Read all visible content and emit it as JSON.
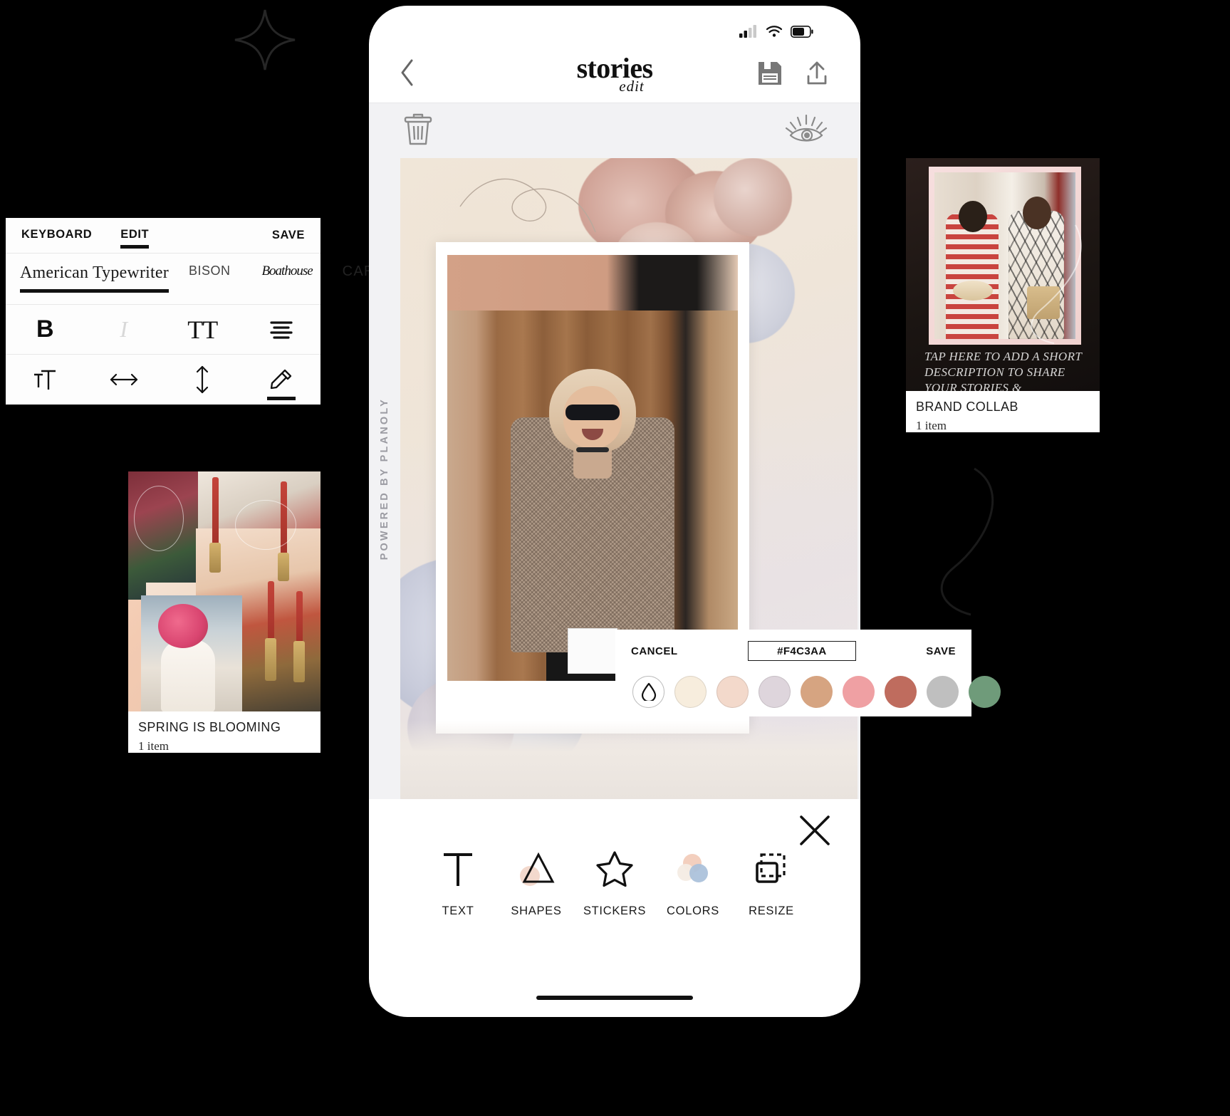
{
  "text_panel": {
    "tabs": [
      {
        "label": "KEYBOARD",
        "active": false
      },
      {
        "label": "EDIT",
        "active": true
      }
    ],
    "save_label": "SAVE",
    "fonts": [
      {
        "label": "American Typewriter",
        "active": true
      },
      {
        "label": "BISON",
        "active": false
      },
      {
        "label": "Boathouse",
        "active": false
      },
      {
        "label": "CARROL",
        "active": false
      }
    ],
    "format_row": [
      {
        "icon": "bold-icon",
        "label": "B",
        "active": true
      },
      {
        "icon": "italic-icon",
        "label": "I",
        "active": false
      },
      {
        "icon": "text-case-icon",
        "label": "TT",
        "active": false
      },
      {
        "icon": "align-center-icon",
        "label": "",
        "active": false
      }
    ],
    "spacing_row": [
      {
        "icon": "font-size-icon",
        "active": false
      },
      {
        "icon": "letter-spacing-icon",
        "active": false
      },
      {
        "icon": "line-height-icon",
        "active": false
      },
      {
        "icon": "color-eyedropper-icon",
        "active": true
      }
    ]
  },
  "phone": {
    "status": {
      "signal": "signal-bars-icon",
      "wifi": "wifi-icon",
      "battery": "battery-icon"
    },
    "nav": {
      "back_icon": "chevron-left-icon",
      "title": "stories",
      "subtitle": "edit",
      "save_icon": "floppy-save-icon",
      "share_icon": "upload-share-icon"
    },
    "canvas_bar": {
      "delete_icon": "trash-icon",
      "preview_icon": "eye-lashes-icon"
    },
    "watermark": "POWERED BY PLANOLY",
    "close_icon": "close-x-icon",
    "toolbar": [
      {
        "icon": "text-t-icon",
        "label": "TEXT"
      },
      {
        "icon": "shapes-triangle-icon",
        "label": "SHAPES"
      },
      {
        "icon": "star-sticker-icon",
        "label": "STICKERS"
      },
      {
        "icon": "color-circles-icon",
        "label": "COLORS"
      },
      {
        "icon": "resize-frame-icon",
        "label": "RESIZE"
      }
    ]
  },
  "color_picker": {
    "cancel_label": "CANCEL",
    "save_label": "SAVE",
    "hex_value": "#F4C3AA",
    "swatches": [
      {
        "name": "eyedropper",
        "color": "#FFFFFF",
        "icon": "eyedropper-drop-icon"
      },
      {
        "name": "cream",
        "color": "#F7EDDD"
      },
      {
        "name": "blush",
        "color": "#F3D9CB"
      },
      {
        "name": "lilac-grey",
        "color": "#DED5DC"
      },
      {
        "name": "tan",
        "color": "#D6A481"
      },
      {
        "name": "rose",
        "color": "#EFA0A3"
      },
      {
        "name": "terracotta",
        "color": "#BF6C5E"
      },
      {
        "name": "grey",
        "color": "#BFBFBF"
      },
      {
        "name": "sage",
        "color": "#6F9B7A"
      }
    ]
  },
  "cards": [
    {
      "name": "spring-card",
      "title": "SPRING IS BLOOMING",
      "subtitle": "1 item"
    },
    {
      "name": "brand-collab-card",
      "title": "BRAND COLLAB",
      "subtitle": "1 item",
      "overlay_caption": "TAP HERE TO ADD A SHORT DESCRIPTION TO SHARE YOUR STORIES &"
    }
  ],
  "colors": {
    "accent_hex": "#F4C3AA",
    "panel_bg": "#FFFFFF",
    "page_bg": "#000000",
    "canvas_bg": "#F2F2F4"
  }
}
